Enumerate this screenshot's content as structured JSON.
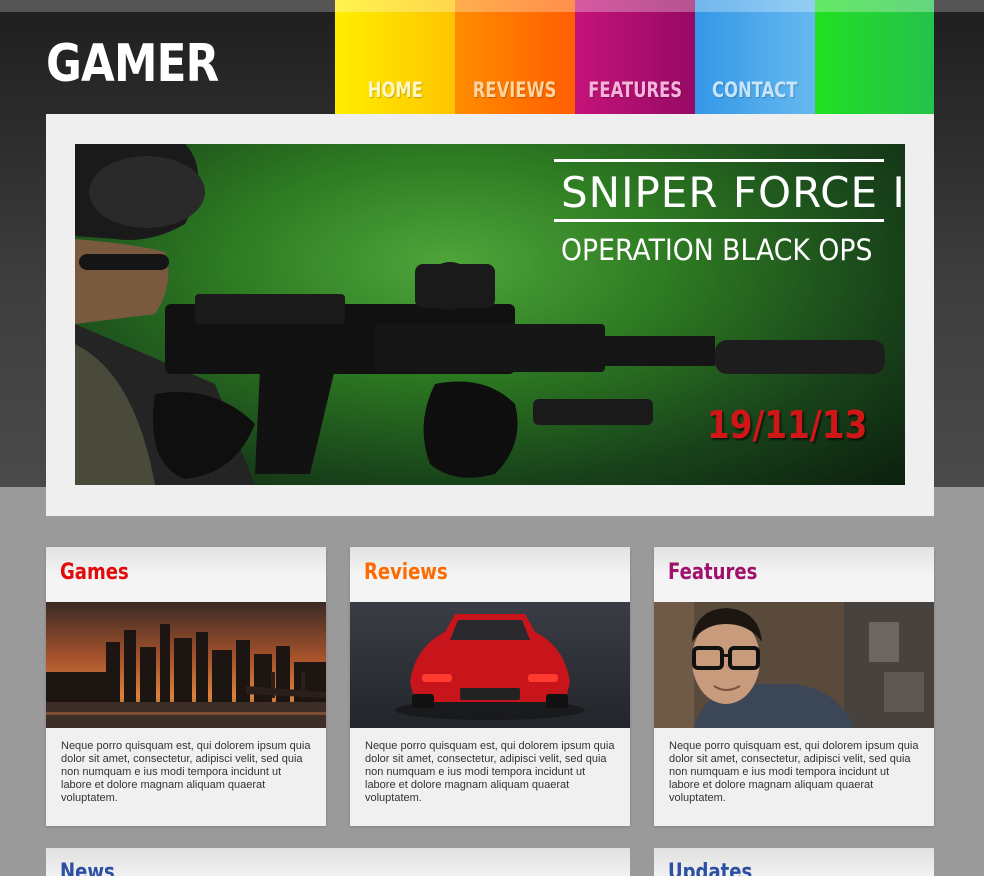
{
  "logo": "GAMER",
  "nav": {
    "items": [
      {
        "label": "HOME"
      },
      {
        "label": "REVIEWS"
      },
      {
        "label": "FEATURES"
      },
      {
        "label": "CONTACT"
      }
    ]
  },
  "hero": {
    "title": "SNIPER FORCE III",
    "subtitle": "OPERATION BLACK OPS",
    "date": "19/11/13"
  },
  "cards": [
    {
      "title": "Games",
      "title_color": "#e20a0a",
      "text": "Neque porro quisquam est, qui dolorem ipsum quia dolor sit amet, consectetur, adipisci velit, sed quia non numquam e ius modi tempora incidunt ut labore et dolore magnam aliquam quaerat voluptatem."
    },
    {
      "title": "Reviews",
      "title_color": "#ff6a00",
      "text": "Neque porro quisquam est, qui dolorem ipsum quia dolor sit amet, consectetur, adipisci velit, sed quia non numquam e ius modi tempora incidunt ut labore et dolore magnam aliquam quaerat voluptatem."
    },
    {
      "title": "Features",
      "title_color": "#a0116b",
      "text": "Neque porro quisquam est, qui dolorem ipsum quia dolor sit amet, consectetur, adipisci velit, sed quia non numquam e ius modi tempora incidunt ut labore et dolore magnam aliquam quaerat voluptatem."
    }
  ],
  "bottom": {
    "news_title": "News",
    "updates_title": "Updates"
  },
  "colors": {
    "home": "#ffd800",
    "reviews": "#ff7000",
    "features": "#b0106f",
    "contact": "#4aa6ea",
    "extra": "#23d23a",
    "date_red": "#d01616",
    "bottom_blue": "#2a4fa3"
  }
}
